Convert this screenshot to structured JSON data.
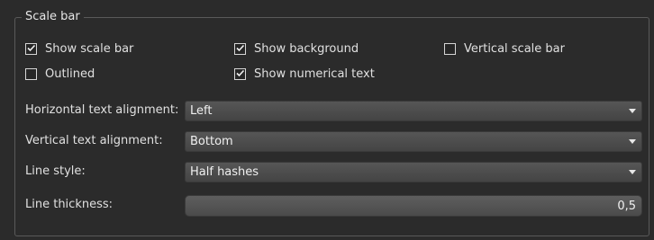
{
  "group": {
    "title": "Scale bar"
  },
  "checkboxes": {
    "show_scale_bar": {
      "label": "Show scale bar",
      "checked": true
    },
    "show_background": {
      "label": "Show background",
      "checked": true
    },
    "vertical_scale_bar": {
      "label": "Vertical scale bar",
      "checked": false
    },
    "outlined": {
      "label": "Outlined",
      "checked": false
    },
    "show_numerical_text": {
      "label": "Show numerical text",
      "checked": true
    }
  },
  "fields": {
    "horizontal_text_alignment": {
      "label": "Horizontal text alignment:",
      "value": "Left"
    },
    "vertical_text_alignment": {
      "label": "Vertical text alignment:",
      "value": "Bottom"
    },
    "line_style": {
      "label": "Line style:",
      "value": "Half hashes"
    },
    "line_thickness": {
      "label": "Line thickness:",
      "value": "0,5"
    }
  },
  "icons": {
    "checkbox_checked": "checkmark-icon",
    "dropdown_arrow": "chevron-down-icon"
  },
  "colors": {
    "background": "#2b2b2b",
    "control": "#4b4b4b",
    "text": "#e0e0e0"
  }
}
